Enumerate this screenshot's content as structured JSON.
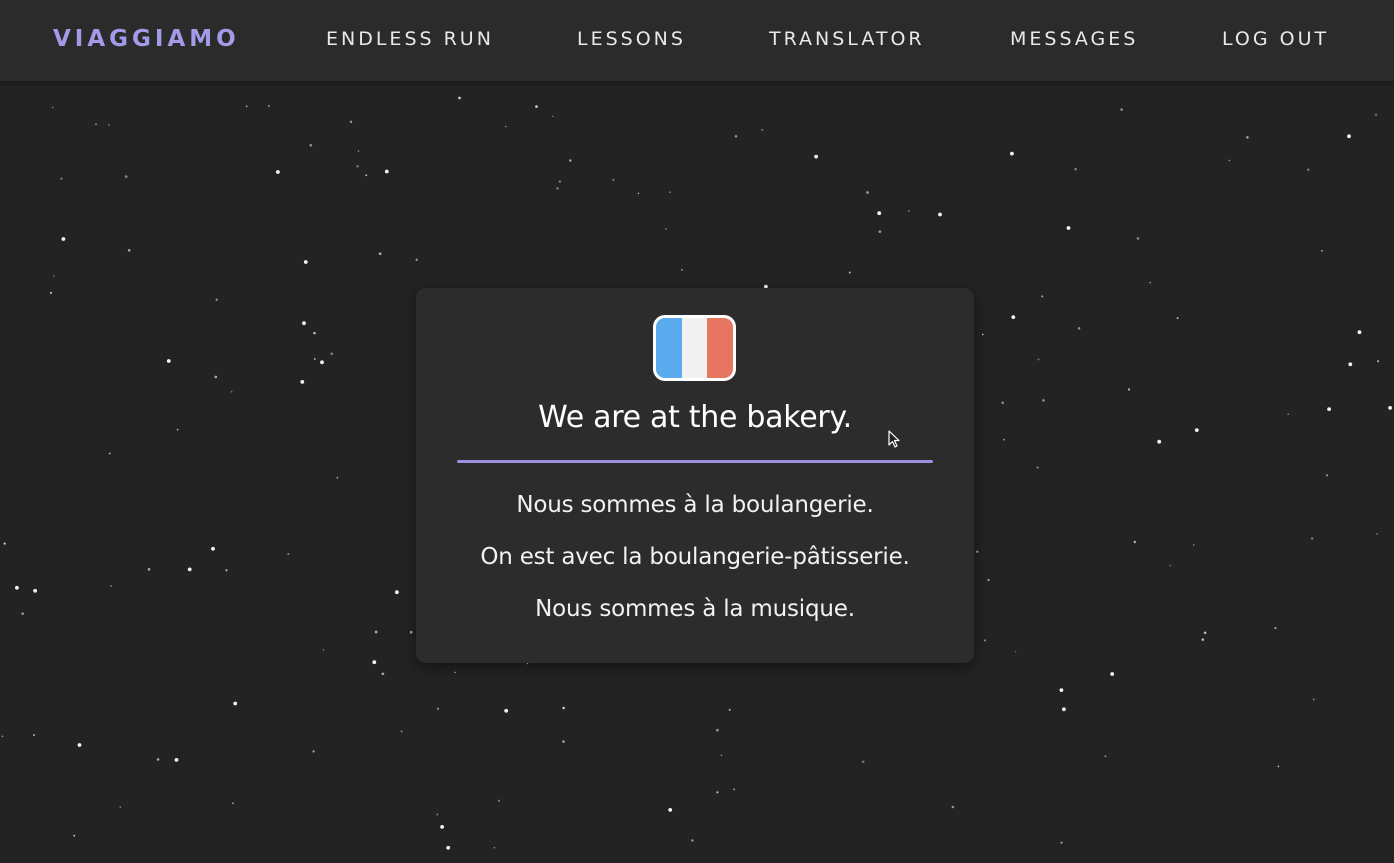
{
  "nav": {
    "brand": "VIAGGIAMO",
    "links": [
      "ENDLESS RUN",
      "LESSONS",
      "TRANSLATOR",
      "MESSAGES",
      "LOG OUT"
    ]
  },
  "colors": {
    "background": "#232323",
    "navbar": "#2b2b2c",
    "card": "#2c2c2d",
    "accent": "#a29be8",
    "divider": "#9b91e0",
    "flag_blue": "#5aacee",
    "flag_white": "#f1f1f1",
    "flag_red": "#e87560"
  },
  "question": {
    "flag_icon": "france-flag-icon",
    "prompt": "We are at the bakery.",
    "options": [
      "Nous sommes à la boulangerie.",
      "On est avec la boulangerie-pâtisserie.",
      "Nous sommes à la musique."
    ]
  }
}
